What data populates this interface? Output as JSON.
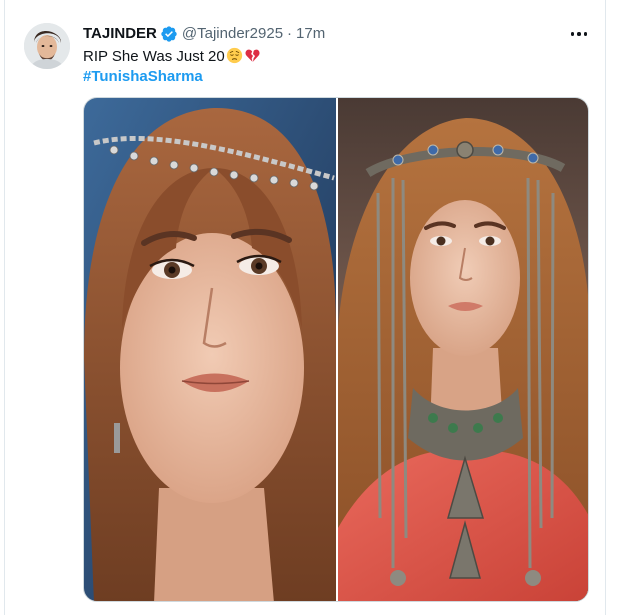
{
  "tweet": {
    "author": {
      "display_name": "TAJINDER",
      "handle": "@Tajinder2925",
      "verified_icon": "verified-badge-icon",
      "avatar_icon": "avatar"
    },
    "separator": "·",
    "time": "17m",
    "more_icon": "more-options-icon",
    "text": "RIP She Was Just 20",
    "emojis": [
      "pensive-face-emoji",
      "broken-heart-emoji"
    ],
    "hashtag": "#TunishaSharma",
    "media": {
      "count": 2,
      "items": [
        {
          "name": "photo-left"
        },
        {
          "name": "photo-right"
        }
      ]
    }
  },
  "colors": {
    "text_primary": "#0f1419",
    "text_secondary": "#536471",
    "link": "#1d9bf0",
    "border": "#cfd9de"
  }
}
